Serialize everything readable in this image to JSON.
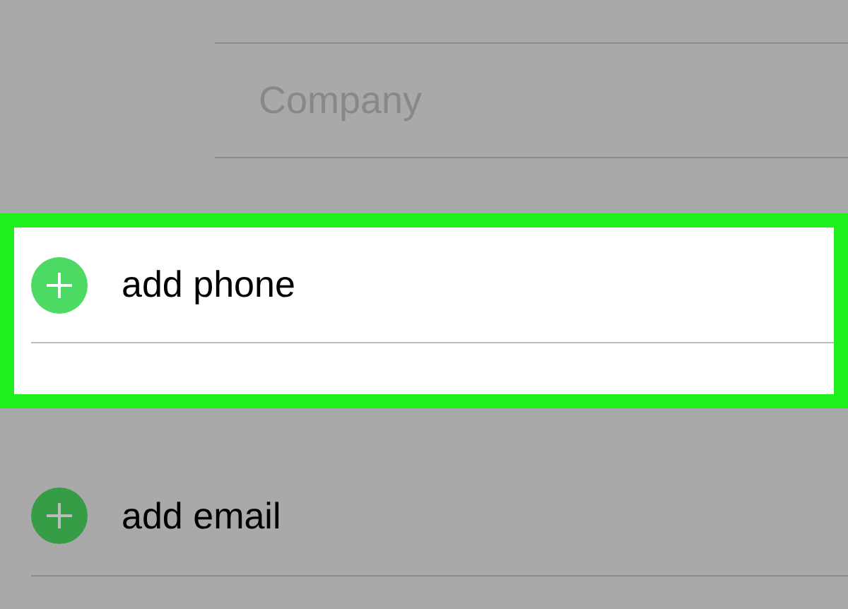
{
  "company_field": {
    "placeholder": "Company"
  },
  "rows": [
    {
      "label": "add phone",
      "highlighted": true
    },
    {
      "label": "add email",
      "highlighted": false
    }
  ]
}
